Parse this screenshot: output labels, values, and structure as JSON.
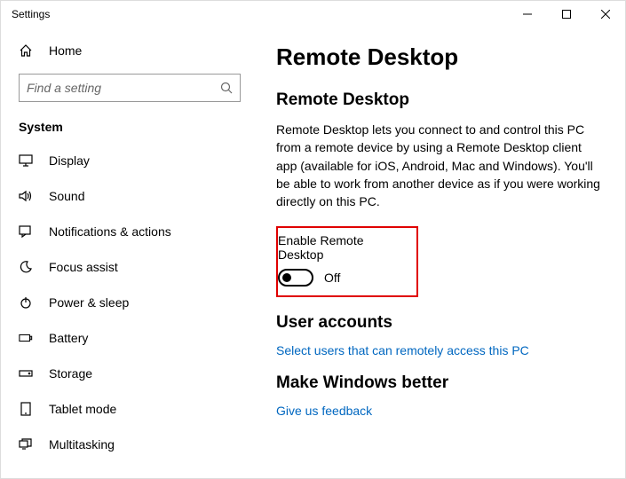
{
  "window": {
    "title": "Settings"
  },
  "sidebar": {
    "home_label": "Home",
    "search_placeholder": "Find a setting",
    "section_title": "System",
    "items": [
      {
        "label": "Display"
      },
      {
        "label": "Sound"
      },
      {
        "label": "Notifications & actions"
      },
      {
        "label": "Focus assist"
      },
      {
        "label": "Power & sleep"
      },
      {
        "label": "Battery"
      },
      {
        "label": "Storage"
      },
      {
        "label": "Tablet mode"
      },
      {
        "label": "Multitasking"
      }
    ]
  },
  "main": {
    "page_title": "Remote Desktop",
    "sec1": {
      "heading": "Remote Desktop",
      "body": "Remote Desktop lets you connect to and control this PC from a remote device by using a Remote Desktop client app (available for iOS, Android, Mac and Windows). You'll be able to work from another device as if you were working directly on this PC.",
      "toggle_label": "Enable Remote Desktop",
      "toggle_state": "Off"
    },
    "sec2": {
      "heading": "User accounts",
      "link": "Select users that can remotely access this PC"
    },
    "sec3": {
      "heading": "Make Windows better",
      "link": "Give us feedback"
    }
  }
}
